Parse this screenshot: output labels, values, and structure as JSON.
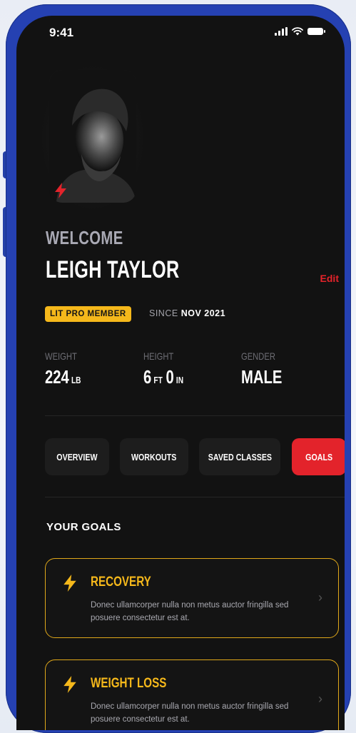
{
  "status_bar": {
    "time": "9:41"
  },
  "profile": {
    "welcome": "WELCOME",
    "name": "LEIGH TAYLOR",
    "edit_label": "Edit",
    "badge": "LIT PRO MEMBER",
    "since_label": "SINCE",
    "since_value": "NOV 2021"
  },
  "stats": [
    {
      "label": "WEIGHT",
      "value": "224",
      "unit": "LB"
    },
    {
      "label": "HEIGHT",
      "value_ft": "6",
      "unit_ft": "FT",
      "value_in": "0",
      "unit_in": "IN"
    },
    {
      "label": "GENDER",
      "value": "MALE"
    }
  ],
  "tabs": [
    {
      "label": "OVERVIEW",
      "active": false
    },
    {
      "label": "WORKOUTS",
      "active": false
    },
    {
      "label": "SAVED CLASSES",
      "active": false
    },
    {
      "label": "GOALS",
      "active": true
    }
  ],
  "goals": {
    "heading": "YOUR GOALS",
    "items": [
      {
        "title": "RECOVERY",
        "description": "Donec ullamcorper nulla non metus auctor fringilla sed posuere consectetur est at."
      },
      {
        "title": "WEIGHT LOSS",
        "description": "Donec ullamcorper nulla non metus auctor fringilla sed posuere consectetur est at."
      }
    ]
  },
  "colors": {
    "accent_red": "#e3232b",
    "accent_yellow": "#f5b81b",
    "phone_frame": "#2541b2",
    "screen_bg": "#121212"
  },
  "icons": [
    "signal-icon",
    "wifi-icon",
    "battery-icon",
    "bolt-icon",
    "chevron-right-icon"
  ]
}
